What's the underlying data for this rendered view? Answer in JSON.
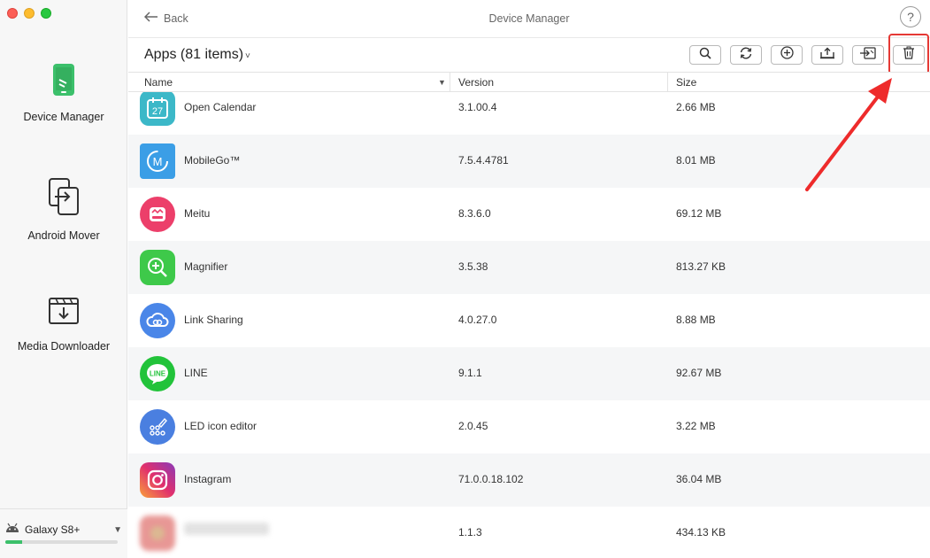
{
  "window": {
    "title": "Device Manager"
  },
  "sidebar": {
    "items": [
      {
        "label": "Device Manager",
        "icon": "phone-icon",
        "active": true
      },
      {
        "label": "Android Mover",
        "icon": "transfer-icon"
      },
      {
        "label": "Media Downloader",
        "icon": "download-icon"
      }
    ],
    "device": {
      "name": "Galaxy S8+",
      "storage_used_fraction": 0.15,
      "storage_color": "#3cc06b"
    }
  },
  "header": {
    "back_label": "Back",
    "help_label": "?"
  },
  "toolbar": {
    "apps_title": "Apps (81 items)",
    "buttons": [
      "search-icon",
      "refresh-icon",
      "add-icon",
      "export-icon",
      "import-icon",
      "trash-icon"
    ]
  },
  "table": {
    "columns": {
      "name": "Name",
      "version": "Version",
      "size": "Size"
    },
    "rows": [
      {
        "name": "Open Calendar",
        "version": "3.1.00.4",
        "size": "2.66 MB"
      },
      {
        "name": "MobileGo™",
        "version": "7.5.4.4781",
        "size": "8.01 MB"
      },
      {
        "name": "Meitu",
        "version": "8.3.6.0",
        "size": "69.12 MB"
      },
      {
        "name": "Magnifier",
        "version": "3.5.38",
        "size": "813.27 KB"
      },
      {
        "name": "Link Sharing",
        "version": "4.0.27.0",
        "size": "8.88 MB"
      },
      {
        "name": "LINE",
        "version": "9.1.1",
        "size": "92.67 MB"
      },
      {
        "name": "LED icon editor",
        "version": "2.0.45",
        "size": "3.22 MB"
      },
      {
        "name": "Instagram",
        "version": "71.0.0.18.102",
        "size": "36.04 MB"
      },
      {
        "name": "",
        "version": "1.1.3",
        "size": "434.13 KB"
      }
    ]
  },
  "colors": {
    "accent_green": "#3cc06b",
    "highlight_red": "#e53935"
  }
}
